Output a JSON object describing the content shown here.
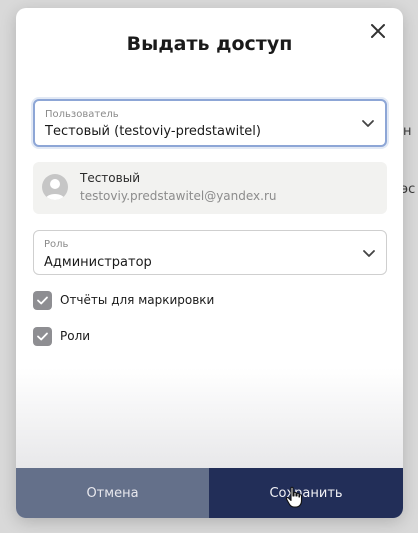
{
  "backdrop": {
    "right_text_1": "н",
    "right_text_2": "эс"
  },
  "modal": {
    "title": "Выдать доступ",
    "close_icon": "close-icon"
  },
  "user_field": {
    "label": "Пользователь",
    "value": "Тестовый (testoviy-predstawitel)",
    "icon": "chevron-down-icon"
  },
  "user_card": {
    "name": "Тестовый",
    "email": "testoviy.predstawitel@yandex.ru",
    "avatar_icon": "user-avatar-icon"
  },
  "role_field": {
    "label": "Роль",
    "value": "Администратор",
    "icon": "chevron-down-icon"
  },
  "permissions": [
    {
      "label": "Отчёты для маркировки",
      "checked": true
    },
    {
      "label": "Роли",
      "checked": true
    }
  ],
  "footer": {
    "cancel_label": "Отмена",
    "save_label": "Сохранить"
  },
  "colors": {
    "cancel_bg": "#64708a",
    "save_bg": "#222e58",
    "checkbox_bg": "#8e8e92",
    "focus_border": "#8da6d6"
  }
}
